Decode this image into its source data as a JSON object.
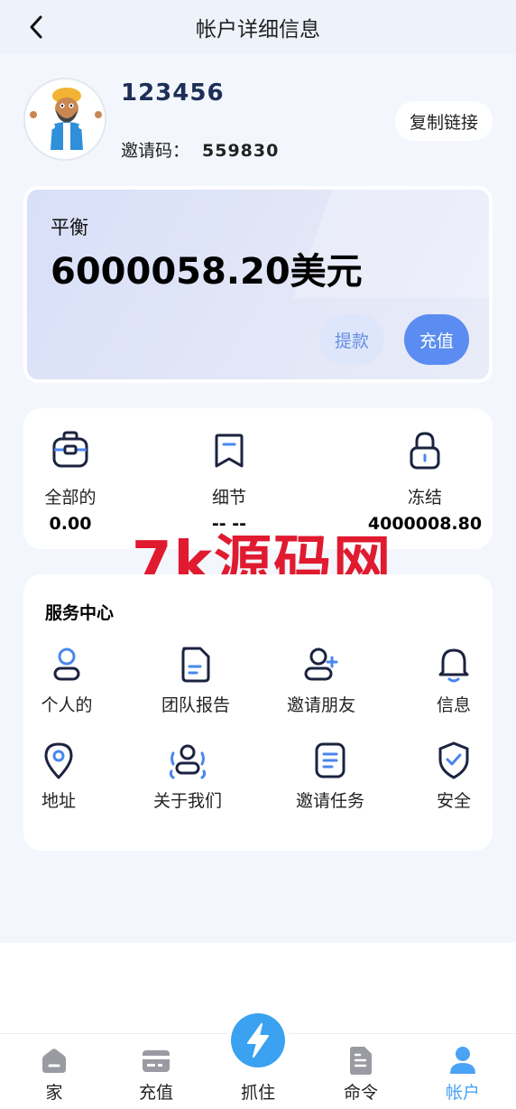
{
  "header": {
    "title": "帐户详细信息"
  },
  "profile": {
    "username": "123456",
    "invite_label": "邀请码：",
    "invite_code": "559830",
    "copy_link": "复制链接"
  },
  "balance": {
    "label": "平衡",
    "amount": "6000058.20美元",
    "withdraw": "提款",
    "recharge": "充值"
  },
  "stats": [
    {
      "label": "全部的",
      "value": "0.00",
      "icon": "briefcase-icon"
    },
    {
      "label": "细节",
      "value": "-- --",
      "icon": "bookmark-icon"
    },
    {
      "label": "冻结",
      "value": "4000008.80",
      "icon": "lock-icon"
    }
  ],
  "watermark": "7k源码网",
  "services": {
    "title": "服务中心",
    "items": [
      {
        "label": "个人的",
        "icon": "person-icon"
      },
      {
        "label": "团队报告",
        "icon": "report-icon"
      },
      {
        "label": "邀请朋友",
        "icon": "add-friend-icon"
      },
      {
        "label": "信息",
        "icon": "bell-icon"
      },
      {
        "label": "地址",
        "icon": "location-icon"
      },
      {
        "label": "关于我们",
        "icon": "about-us-icon"
      },
      {
        "label": "邀请任务",
        "icon": "task-icon"
      },
      {
        "label": "安全",
        "icon": "shield-icon"
      }
    ]
  },
  "tabbar": {
    "items": [
      {
        "label": "家",
        "icon": "home-icon"
      },
      {
        "label": "充值",
        "icon": "card-icon"
      },
      {
        "label": "抓住",
        "icon": "lightning-icon"
      },
      {
        "label": "命令",
        "icon": "document-icon"
      },
      {
        "label": "帐户",
        "icon": "user-icon"
      }
    ],
    "active": "帐户"
  },
  "colors": {
    "accent": "#5b8cf1",
    "active_tab": "#4aa3f4",
    "watermark": "#e01a2f",
    "icon_dark": "#1b2340"
  }
}
